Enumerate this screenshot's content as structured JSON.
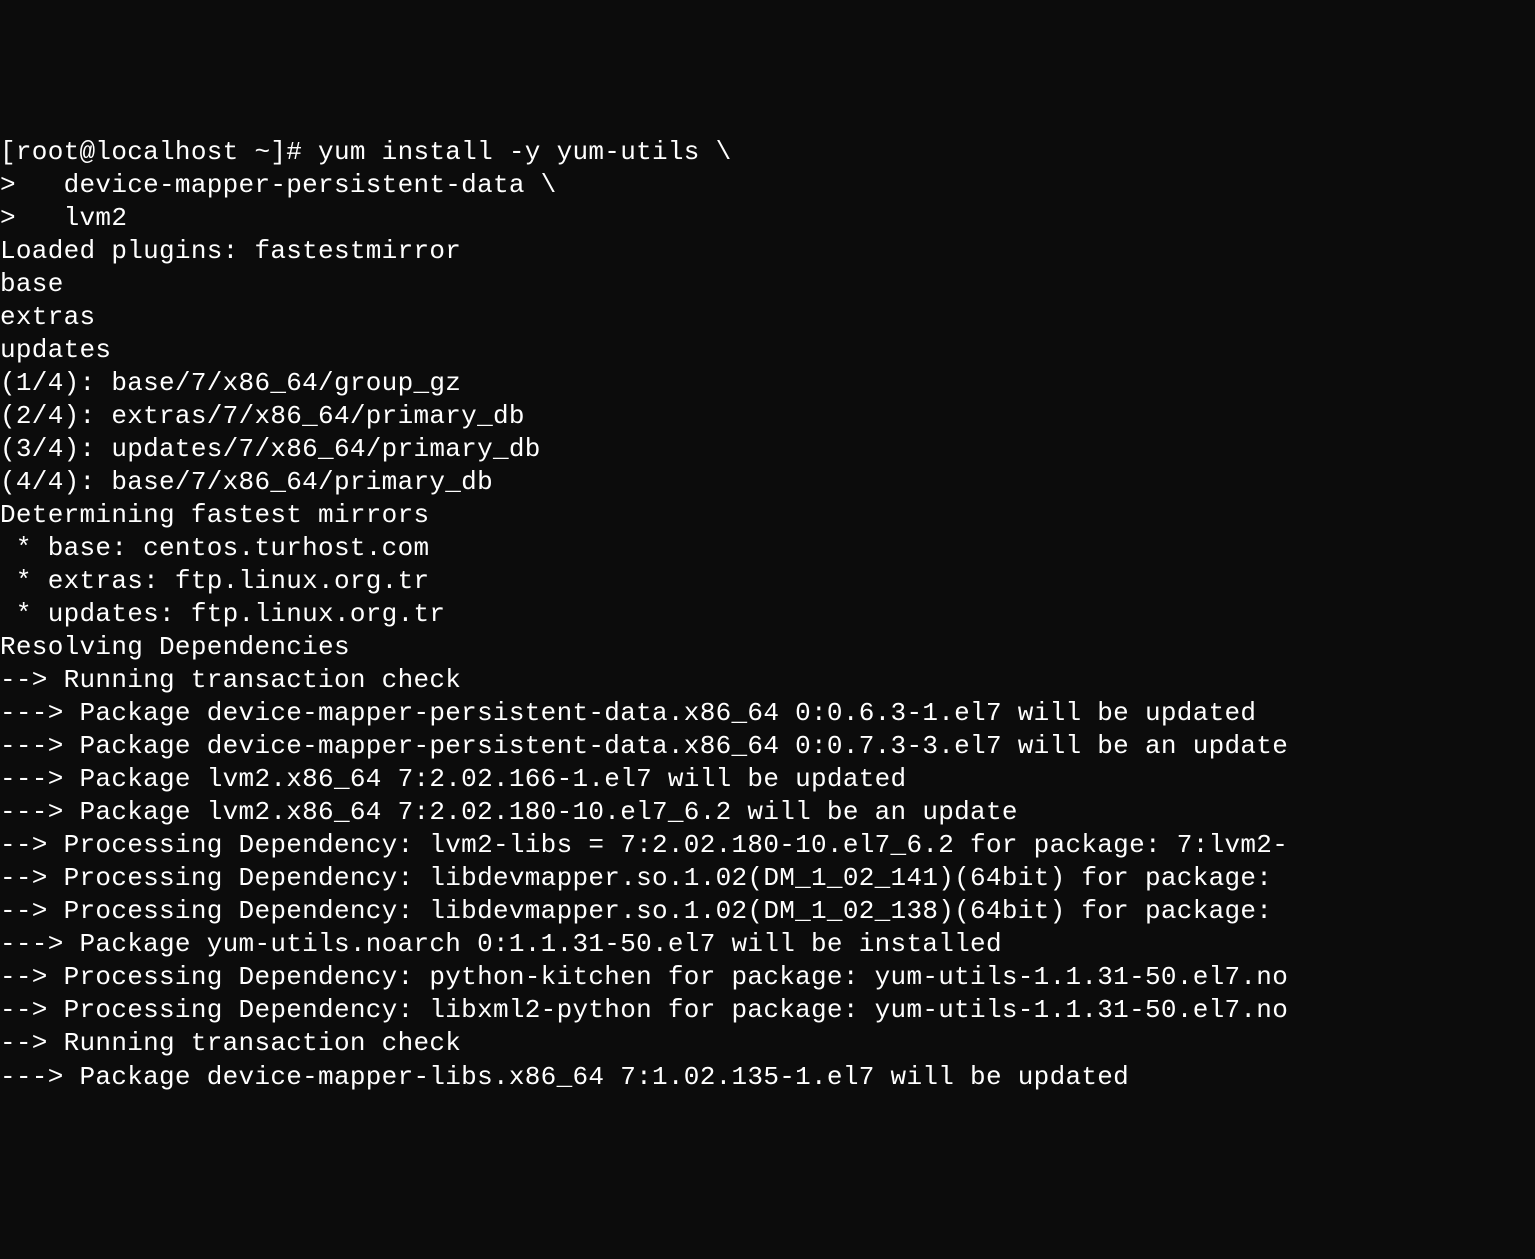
{
  "terminal": {
    "lines": [
      "[root@localhost ~]# yum install -y yum-utils \\",
      ">   device-mapper-persistent-data \\",
      ">   lvm2",
      "Loaded plugins: fastestmirror",
      "base",
      "extras",
      "updates",
      "(1/4): base/7/x86_64/group_gz",
      "(2/4): extras/7/x86_64/primary_db",
      "(3/4): updates/7/x86_64/primary_db",
      "(4/4): base/7/x86_64/primary_db",
      "Determining fastest mirrors",
      " * base: centos.turhost.com",
      " * extras: ftp.linux.org.tr",
      " * updates: ftp.linux.org.tr",
      "Resolving Dependencies",
      "--> Running transaction check",
      "---> Package device-mapper-persistent-data.x86_64 0:0.6.3-1.el7 will be updated",
      "---> Package device-mapper-persistent-data.x86_64 0:0.7.3-3.el7 will be an update",
      "---> Package lvm2.x86_64 7:2.02.166-1.el7 will be updated",
      "---> Package lvm2.x86_64 7:2.02.180-10.el7_6.2 will be an update",
      "--> Processing Dependency: lvm2-libs = 7:2.02.180-10.el7_6.2 for package: 7:lvm2-",
      "--> Processing Dependency: libdevmapper.so.1.02(DM_1_02_141)(64bit) for package: ",
      "--> Processing Dependency: libdevmapper.so.1.02(DM_1_02_138)(64bit) for package: ",
      "---> Package yum-utils.noarch 0:1.1.31-50.el7 will be installed",
      "--> Processing Dependency: python-kitchen for package: yum-utils-1.1.31-50.el7.no",
      "--> Processing Dependency: libxml2-python for package: yum-utils-1.1.31-50.el7.no",
      "--> Running transaction check",
      "---> Package device-mapper-libs.x86_64 7:1.02.135-1.el7 will be updated"
    ]
  }
}
